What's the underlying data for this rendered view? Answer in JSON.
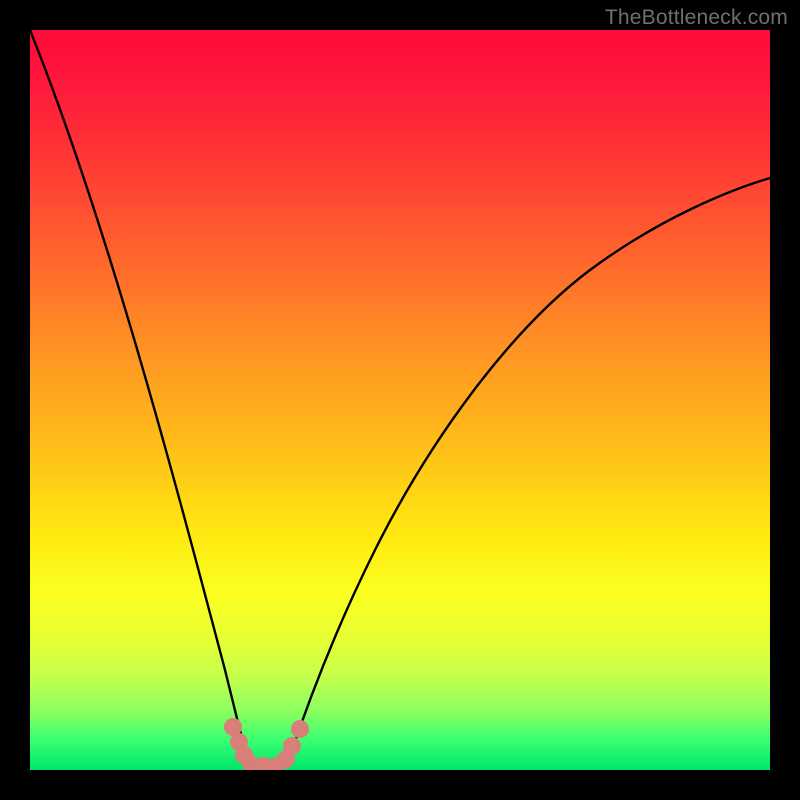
{
  "watermark": "TheBottleneck.com",
  "chart_data": {
    "type": "line",
    "title": "",
    "xlabel": "",
    "ylabel": "",
    "xlim": [
      0,
      100
    ],
    "ylim": [
      0,
      100
    ],
    "background_gradient": {
      "direction": "vertical",
      "stops": [
        {
          "pos": 0,
          "color": "#ff0a3a"
        },
        {
          "pos": 18,
          "color": "#ff3a34"
        },
        {
          "pos": 45,
          "color": "#ff9a22"
        },
        {
          "pos": 68,
          "color": "#ffe810"
        },
        {
          "pos": 82,
          "color": "#e8ff34"
        },
        {
          "pos": 96,
          "color": "#38ff70"
        },
        {
          "pos": 100,
          "color": "#00e56a"
        }
      ]
    },
    "series": [
      {
        "name": "bottleneck-left-branch",
        "color": "#000000",
        "x": [
          0,
          5,
          10,
          15,
          20,
          22,
          24,
          25,
          26,
          27,
          28
        ],
        "y": [
          100,
          82,
          63,
          44,
          24,
          15,
          8,
          5,
          3,
          1,
          0
        ]
      },
      {
        "name": "bottleneck-right-branch",
        "color": "#000000",
        "x": [
          33,
          34,
          35,
          37,
          40,
          45,
          50,
          60,
          70,
          80,
          90,
          100
        ],
        "y": [
          0,
          2,
          5,
          10,
          18,
          30,
          39,
          54,
          63,
          70,
          75,
          79
        ]
      },
      {
        "name": "bottleneck-minimum-marker",
        "type": "scatter",
        "color": "#d97f7a",
        "x": [
          26,
          27,
          28,
          29,
          30,
          31,
          32,
          33,
          34
        ],
        "y": [
          4,
          2,
          1,
          0,
          0,
          0,
          1,
          2,
          5
        ]
      }
    ],
    "minimum_region": {
      "x_start": 26,
      "x_end": 34,
      "y": 0
    }
  }
}
